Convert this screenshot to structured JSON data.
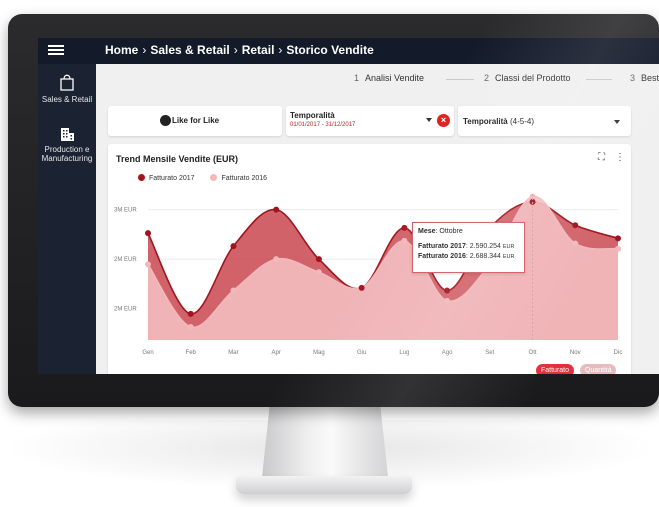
{
  "topbar": {
    "breadcrumb": [
      "Home",
      "Sales & Retail",
      "Retail",
      "Storico Vendite"
    ],
    "separator": "›"
  },
  "sidebar": {
    "items": [
      {
        "label": "Sales & Retail",
        "icon": "shopping-bag-icon"
      },
      {
        "label": "Production e Manufacturing",
        "icon": "building-icon"
      }
    ]
  },
  "stepper": {
    "steps": [
      {
        "num": "1",
        "label": "Analisi Vendite"
      },
      {
        "num": "2",
        "label": "Classi del Prodotto"
      },
      {
        "num": "3",
        "label": "Best Se"
      }
    ]
  },
  "filters": {
    "like_for_like": "Like for Like",
    "temporalita_title": "Temporalità",
    "temporalita_range": "01/01/2017 - 31/12/2017",
    "calendar_label": "Temporalità",
    "calendar_value": "(4-5-4)"
  },
  "chart": {
    "title": "Trend Mensile Vendite (EUR)",
    "tools": [
      "⛶",
      "⋮"
    ],
    "toggles": [
      "Fatturato",
      "Quantità"
    ],
    "tooltip": {
      "month_label": "Mese",
      "month_value": "Ottobre",
      "line1_label": "Fatturato 2017",
      "line1_value": "2.590.254",
      "line1_unit": "EUR",
      "line2_label": "Fatturato 2016",
      "line2_value": "2.688.344",
      "line2_unit": "EUR"
    }
  },
  "chart_data": {
    "type": "area",
    "title": "Trend Mensile Vendite (EUR)",
    "categories": [
      "Gen",
      "Feb",
      "Mar",
      "Apr",
      "Mag",
      "Giu",
      "Lug",
      "Ago",
      "Set",
      "Ott",
      "Nov",
      "Dic"
    ],
    "y_tick_labels": [
      "3M EUR",
      "2M EUR",
      "2M EUR"
    ],
    "ylim": [
      0.4,
      3.2
    ],
    "series": [
      {
        "name": "Fatturato 2017",
        "color": "#a0141f",
        "fill": "#c9474f",
        "values": [
          2.45,
          0.9,
          2.2,
          2.9,
          1.95,
          1.4,
          2.55,
          1.35,
          2.55,
          3.05,
          2.6,
          2.35
        ]
      },
      {
        "name": "Fatturato 2016",
        "color": "#f2b8bb",
        "fill": "#f3bcbf",
        "values": [
          1.85,
          0.65,
          1.35,
          1.95,
          1.7,
          1.4,
          2.3,
          1.15,
          1.85,
          3.15,
          2.25,
          2.15
        ]
      }
    ],
    "legend_position": "top-left",
    "grid": true
  }
}
